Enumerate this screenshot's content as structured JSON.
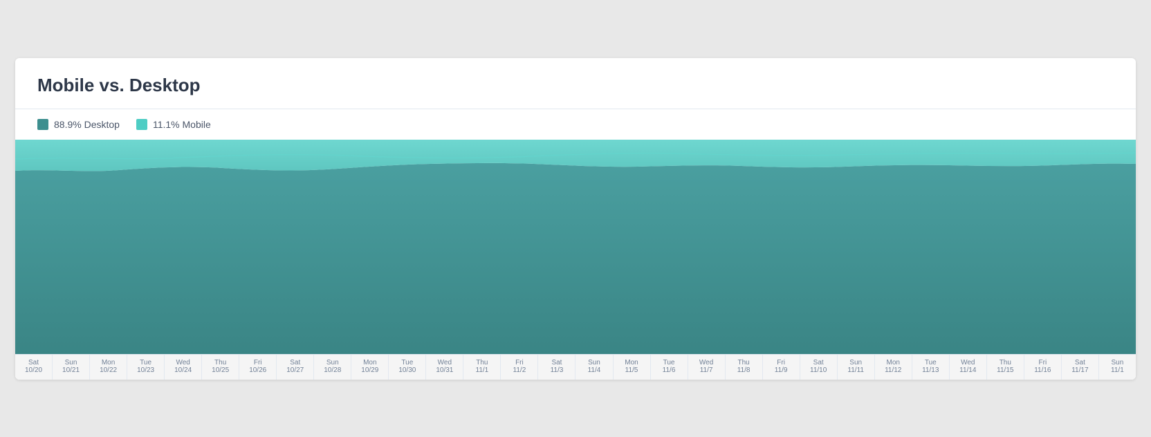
{
  "card": {
    "title": "Mobile vs. Desktop"
  },
  "legend": {
    "desktop_pct": "88.9% Desktop",
    "mobile_pct": "11.1% Mobile",
    "desktop_color": "#3d8f8f",
    "mobile_color": "#4ecdc4"
  },
  "xaxis": {
    "ticks": [
      {
        "day": "Sat",
        "date": "10/20"
      },
      {
        "day": "Sun",
        "date": "10/21"
      },
      {
        "day": "Mon",
        "date": "10/22"
      },
      {
        "day": "Tue",
        "date": "10/23"
      },
      {
        "day": "Wed",
        "date": "10/24"
      },
      {
        "day": "Thu",
        "date": "10/25"
      },
      {
        "day": "Fri",
        "date": "10/26"
      },
      {
        "day": "Sat",
        "date": "10/27"
      },
      {
        "day": "Sun",
        "date": "10/28"
      },
      {
        "day": "Mon",
        "date": "10/29"
      },
      {
        "day": "Tue",
        "date": "10/30"
      },
      {
        "day": "Wed",
        "date": "10/31"
      },
      {
        "day": "Thu",
        "date": "11/1"
      },
      {
        "day": "Fri",
        "date": "11/2"
      },
      {
        "day": "Sat",
        "date": "11/3"
      },
      {
        "day": "Sun",
        "date": "11/4"
      },
      {
        "day": "Mon",
        "date": "11/5"
      },
      {
        "day": "Tue",
        "date": "11/6"
      },
      {
        "day": "Wed",
        "date": "11/7"
      },
      {
        "day": "Thu",
        "date": "11/8"
      },
      {
        "day": "Fri",
        "date": "11/9"
      },
      {
        "day": "Sat",
        "date": "11/10"
      },
      {
        "day": "Sun",
        "date": "11/11"
      },
      {
        "day": "Mon",
        "date": "11/12"
      },
      {
        "day": "Tue",
        "date": "11/13"
      },
      {
        "day": "Wed",
        "date": "11/14"
      },
      {
        "day": "Thu",
        "date": "11/15"
      },
      {
        "day": "Fri",
        "date": "11/16"
      },
      {
        "day": "Sat",
        "date": "11/17"
      },
      {
        "day": "Sun",
        "date": "11/1"
      }
    ]
  }
}
